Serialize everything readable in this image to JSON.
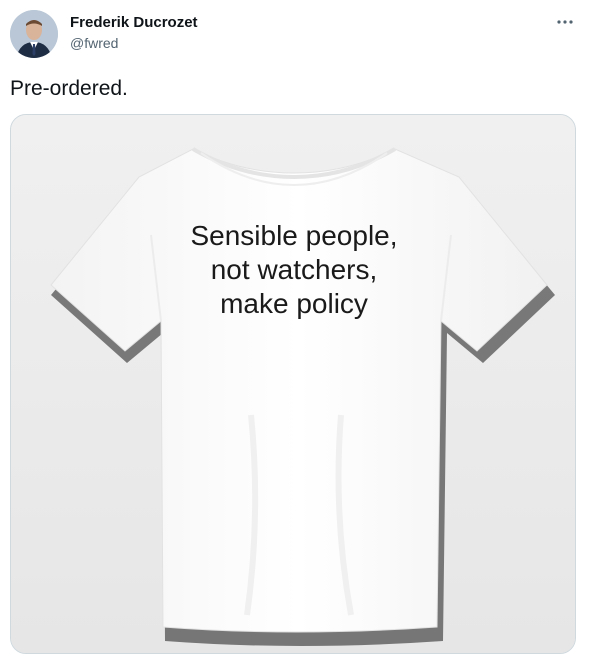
{
  "author": {
    "display_name": "Frederik Ducrozet",
    "handle": "@fwred"
  },
  "tweet": {
    "text": "Pre-ordered."
  },
  "media": {
    "shirt_print_lines": [
      "Sensible people,",
      "not watchers,",
      "make policy"
    ]
  },
  "icons": {
    "more": "more-horizontal-icon"
  },
  "colors": {
    "text_primary": "#0f1419",
    "text_secondary": "#536471",
    "border": "#cfd9de"
  }
}
